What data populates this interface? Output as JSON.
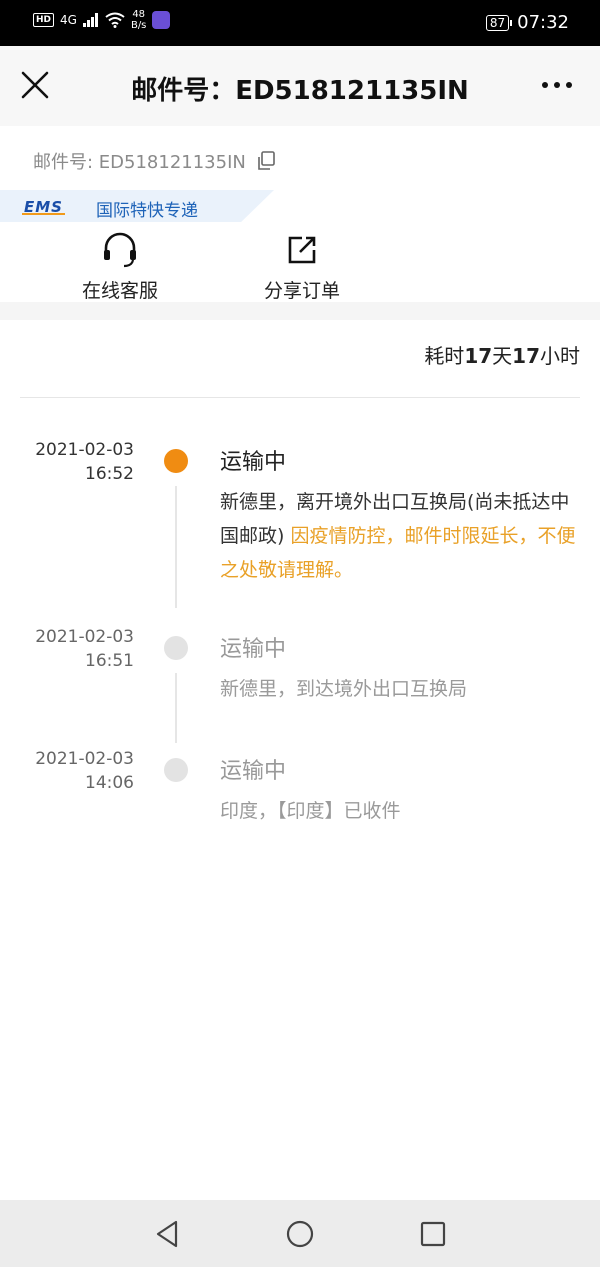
{
  "status_bar": {
    "hd": "HD",
    "network": "4G",
    "speed_value": "48",
    "speed_unit": "B/s",
    "battery": "87",
    "time": "07:32"
  },
  "header": {
    "title": "邮件号：ED518121135IN"
  },
  "order": {
    "number_text": "邮件号: ED518121135IN",
    "carrier_logo": "EMS",
    "carrier_name": "国际特快专递"
  },
  "actions": [
    {
      "label": "在线客服",
      "icon": "headset-icon"
    },
    {
      "label": "分享订单",
      "icon": "share-icon"
    }
  ],
  "duration": {
    "prefix": "耗时",
    "days": "17",
    "days_unit": "天",
    "hours": "17",
    "hours_unit": "小时"
  },
  "timeline": [
    {
      "date": "2021-02-03",
      "time": "16:52",
      "status": "运输中",
      "desc": "新德里，离开境外出口互换局(尚未抵达中国邮政)",
      "notice": " 因疫情防控，邮件时限延长，不便之处敬请理解。",
      "active": true
    },
    {
      "date": "2021-02-03",
      "time": "16:51",
      "status": "运输中",
      "desc": "新德里，到达境外出口互换局",
      "active": false
    },
    {
      "date": "2021-02-03",
      "time": "14:06",
      "status": "运输中",
      "desc": "印度，【印度】已收件",
      "active": false
    }
  ],
  "colors": {
    "active_dot": "#f08c12",
    "notice_text": "#e9a128",
    "ems_blue": "#1a4ea8"
  }
}
